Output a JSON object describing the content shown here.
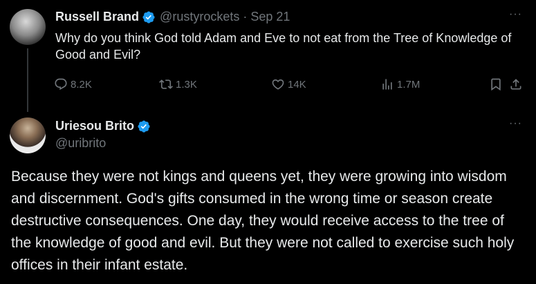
{
  "tweet1": {
    "name": "Russell Brand",
    "handle": "@rustyrockets",
    "separator": "·",
    "date": "Sep 21",
    "text": "Why do you think God told Adam and Eve to not eat from the Tree of Knowledge of Good and Evil?",
    "more": "···",
    "stats": {
      "replies": "8.2K",
      "retweets": "1.3K",
      "likes": "14K",
      "views": "1.7M"
    }
  },
  "tweet2": {
    "name": "Uriesou Brito",
    "handle": "@uribrito",
    "more": "···",
    "text": "Because they were not kings and queens yet, they were growing into wisdom and discernment. God's gifts consumed in the wrong time or season create destructive consequences. One day, they would receive access to the tree of the knowledge of good and evil. But they were not called to exercise such holy offices in their infant estate."
  },
  "colors": {
    "background": "#000000",
    "text": "#e7e9ea",
    "muted": "#71767b",
    "verified": "#1d9bf0"
  }
}
